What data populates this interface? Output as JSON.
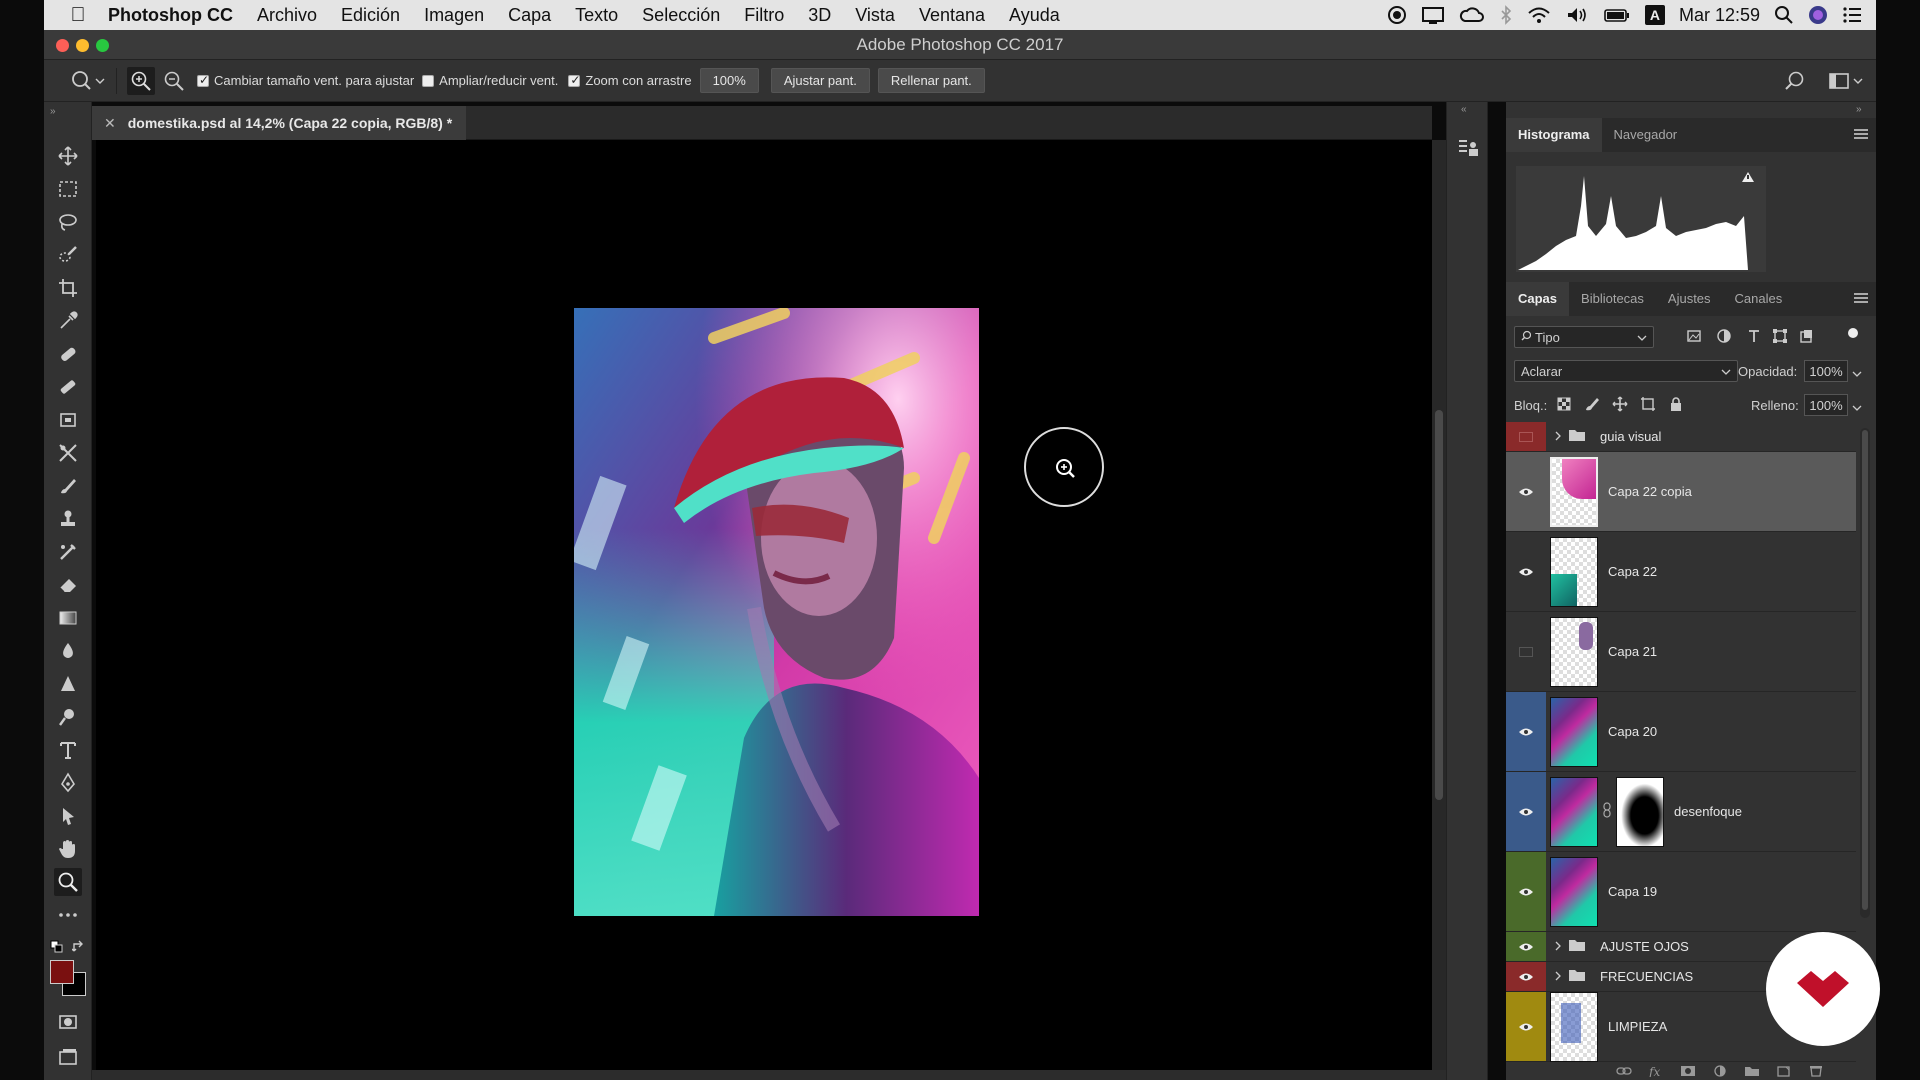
{
  "menubar": {
    "items": [
      "Photoshop CC",
      "Archivo",
      "Edición",
      "Imagen",
      "Capa",
      "Texto",
      "Selección",
      "Filtro",
      "3D",
      "Vista",
      "Ventana",
      "Ayuda"
    ],
    "clock": "Mar 12:59",
    "input_source": "A"
  },
  "window": {
    "title": "Adobe Photoshop CC 2017"
  },
  "options": {
    "resize_windows": "Cambiar tamaño vent. para ajustar",
    "zoom_all": "Ampliar/reducir vent.",
    "scrubby_zoom": "Zoom con arrastre",
    "zoom_value": "100%",
    "fit_screen": "Ajustar pant.",
    "fill_screen": "Rellenar pant."
  },
  "document": {
    "tab_title": "domestika.psd al 14,2% (Capa 22 copia, RGB/8) *"
  },
  "panels": {
    "top_tabs": [
      "Histograma",
      "Navegador"
    ],
    "layer_tabs": [
      "Capas",
      "Bibliotecas",
      "Ajustes",
      "Canales"
    ],
    "filter_kind": "Tipo",
    "blend_mode": "Aclarar",
    "opacity_label": "Opacidad:",
    "opacity_value": "100%",
    "lock_label": "Bloq.:",
    "fill_label": "Relleno:",
    "fill_value": "100%"
  },
  "layers": [
    {
      "name": "guia visual",
      "type": "group",
      "visible": false,
      "color": "#8a2a2a"
    },
    {
      "name": "Capa 22 copia",
      "type": "layer",
      "visible": true,
      "color": "",
      "selected": true
    },
    {
      "name": "Capa 22",
      "type": "layer",
      "visible": true,
      "color": ""
    },
    {
      "name": "Capa 21",
      "type": "layer",
      "visible": false,
      "color": ""
    },
    {
      "name": "Capa 20",
      "type": "layer",
      "visible": true,
      "color": "#3a5a8a"
    },
    {
      "name": "desenfoque",
      "type": "masked",
      "visible": true,
      "color": "#3a5a8a"
    },
    {
      "name": "Capa 19",
      "type": "layer",
      "visible": true,
      "color": "#4a6a2a"
    },
    {
      "name": "AJUSTE OJOS",
      "type": "group",
      "visible": true,
      "color": "#4a6a2a"
    },
    {
      "name": "FRECUENCIAS",
      "type": "group",
      "visible": true,
      "color": "#8a2a2a"
    },
    {
      "name": "LIMPIEZA",
      "type": "layer",
      "visible": true,
      "color": "#a08a10"
    }
  ],
  "colors": {
    "foreground": "#7a1010",
    "background": "#000000",
    "badge": "#c0102a"
  }
}
